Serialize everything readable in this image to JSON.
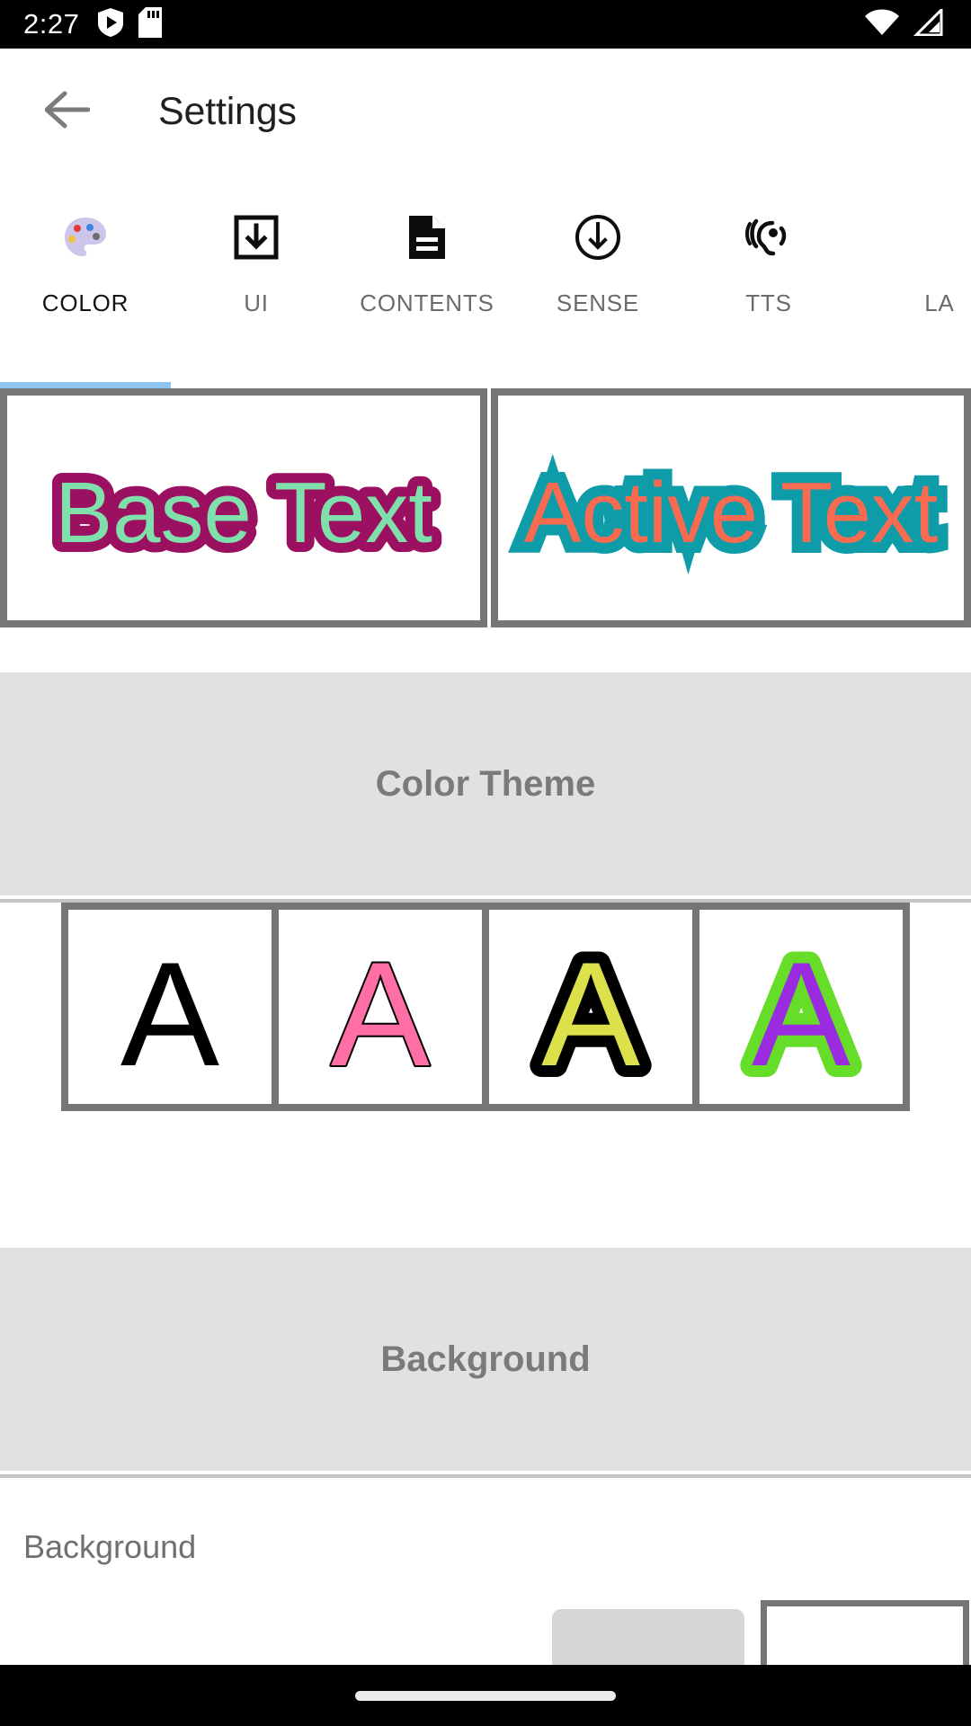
{
  "status_bar": {
    "time": "2:27",
    "icons": [
      "play-protect-shield-icon",
      "sd-card-icon"
    ],
    "right_icons": [
      "wifi-icon",
      "cell-signal-icon"
    ],
    "background": "#000000"
  },
  "app_bar": {
    "back_icon": "back-arrow-icon",
    "title": "Settings"
  },
  "tabs": {
    "active_index": 0,
    "indicator_color": "#8ec5f0",
    "items": [
      {
        "label": "COLOR",
        "icon": "palette-icon",
        "active": true
      },
      {
        "label": "UI",
        "icon": "download-box-icon",
        "active": false
      },
      {
        "label": "CONTENTS",
        "icon": "document-icon",
        "active": false
      },
      {
        "label": "SENSE",
        "icon": "circle-down-arrow-icon",
        "active": false
      },
      {
        "label": "TTS",
        "icon": "hearing-ear-icon",
        "active": false
      },
      {
        "label": "LA",
        "icon": "",
        "active": false
      }
    ]
  },
  "preview": {
    "base": {
      "text": "Base Text",
      "fill_color": "#7FE0AB",
      "stroke_color": "#9B1060",
      "border_color": "#767676",
      "background": "#FFFFFF"
    },
    "active": {
      "text": "Active Text",
      "fill_color": "#F96B50",
      "stroke_color": "#0E9CA8",
      "border_color": "#767676",
      "background": "#FFFFFF"
    }
  },
  "color_theme_section": {
    "header": "Color Theme",
    "header_bg": "#e1e1e1",
    "header_color": "#7a7a7a",
    "swatches": [
      {
        "letter": "A",
        "fill": "#000000",
        "stroke": "#000000",
        "stroke_width": 0,
        "name": "theme-black"
      },
      {
        "letter": "A",
        "fill": "#FF6FA5",
        "stroke": "#000000",
        "stroke_width": 4,
        "name": "theme-pink"
      },
      {
        "letter": "A",
        "fill": "#DCE04A",
        "stroke": "#000000",
        "stroke_width": 26,
        "name": "theme-yellow-black"
      },
      {
        "letter": "A",
        "fill": "#9A2BE0",
        "stroke": "#66DD28",
        "stroke_width": 26,
        "name": "theme-purple-green"
      }
    ]
  },
  "background_section": {
    "header": "Background",
    "header_bg": "#e1e1e1",
    "header_color": "#7a7a7a",
    "row_label": "Background",
    "chip_color": "#d5d7d7",
    "swatch_color": "#ffffff",
    "swatch_border": "#767676"
  },
  "nav_bar": {
    "gesture_pill": "home-gesture-pill",
    "background": "#000000"
  }
}
